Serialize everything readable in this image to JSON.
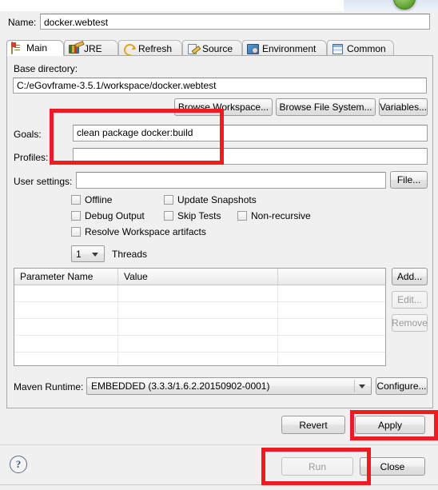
{
  "dialog": {
    "name_label": "Name:",
    "name_value": "docker.webtest"
  },
  "tabs": [
    {
      "label": "Main",
      "icon": "clipboard-icon",
      "selected": true
    },
    {
      "label": "JRE",
      "icon": "books-icon",
      "selected": false
    },
    {
      "label": "Refresh",
      "icon": "refresh-icon",
      "selected": false
    },
    {
      "label": "Source",
      "icon": "source-icon",
      "selected": false
    },
    {
      "label": "Environment",
      "icon": "environment-icon",
      "selected": false
    },
    {
      "label": "Common",
      "icon": "common-icon",
      "selected": false
    }
  ],
  "main": {
    "base_directory_label": "Base directory:",
    "base_directory_value": "C:/eGovframe-3.5.1/workspace/docker.webtest",
    "browse_workspace_label": "Browse Workspace...",
    "browse_file_system_label": "Browse File System...",
    "variables_label": "Variables...",
    "goals_label": "Goals:",
    "goals_value": "clean package docker:build",
    "profiles_label": "Profiles:",
    "profiles_value": "",
    "user_settings_label": "User settings:",
    "user_settings_value": "",
    "file_button_label": "File...",
    "checkboxes": [
      {
        "label": "Offline",
        "checked": false
      },
      {
        "label": "Update Snapshots",
        "checked": false
      },
      {
        "label": "Debug Output",
        "checked": false
      },
      {
        "label": "Skip Tests",
        "checked": false
      },
      {
        "label": "Non-recursive",
        "checked": false
      },
      {
        "label": "Resolve Workspace artifacts",
        "checked": false
      }
    ],
    "threads_value": "1",
    "threads_label": "Threads",
    "table": {
      "columns": [
        "Parameter Name",
        "Value",
        ""
      ],
      "rows": []
    },
    "add_label": "Add...",
    "edit_label": "Edit...",
    "remove_label": "Remove",
    "maven_runtime_label": "Maven Runtime:",
    "maven_runtime_value": "EMBEDDED (3.3.3/1.6.2.20150902-0001)",
    "configure_label": "Configure..."
  },
  "footer": {
    "revert_label": "Revert",
    "apply_label": "Apply",
    "run_label": "Run",
    "close_label": "Close",
    "help_label": "?"
  },
  "annotations": {
    "accent_color": "#ee1c21",
    "highlighted": [
      "goals-field",
      "apply-button",
      "run-button"
    ]
  }
}
